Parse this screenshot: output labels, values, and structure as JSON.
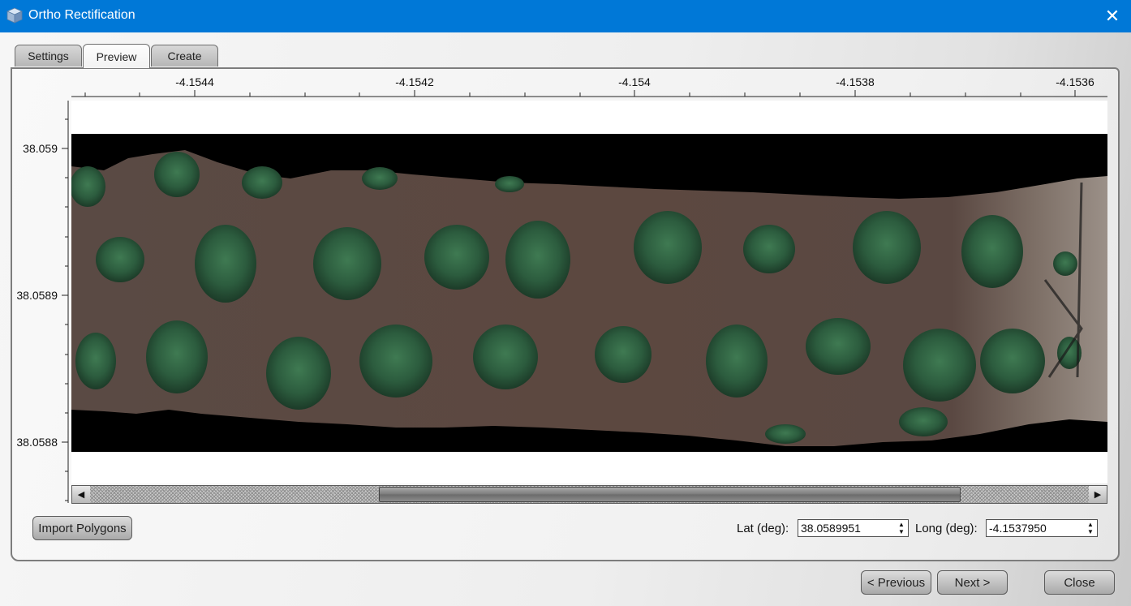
{
  "window": {
    "title": "Ortho Rectification",
    "close_glyph": "✕",
    "icon": "app-cube-icon"
  },
  "tabs": [
    {
      "label": "Settings",
      "active": false
    },
    {
      "label": "Preview",
      "active": true
    },
    {
      "label": "Create",
      "active": false
    }
  ],
  "plot": {
    "x_ticks": [
      "-4.1544",
      "-4.1542",
      "-4.154",
      "-4.1538",
      "-4.1536"
    ],
    "y_ticks": [
      "38.059",
      "38.0589",
      "38.0588"
    ],
    "image": "orthorectified aerial mosaic preview",
    "horizontal_scroll": {
      "left_arrow": "◀",
      "right_arrow": "▶"
    }
  },
  "controls": {
    "import_polygons_label": "Import Polygons",
    "lat_label": "Lat (deg):",
    "lat_value": "38.0589951",
    "long_label": "Long (deg):",
    "long_value": "-4.1537950",
    "spin_up": "▲",
    "spin_down": "▼"
  },
  "footer": {
    "previous_label": "< Previous",
    "next_label": "Next >",
    "close_label": "Close"
  },
  "colors": {
    "titlebar": "#0078d7",
    "panel": "#f1f1f1"
  }
}
